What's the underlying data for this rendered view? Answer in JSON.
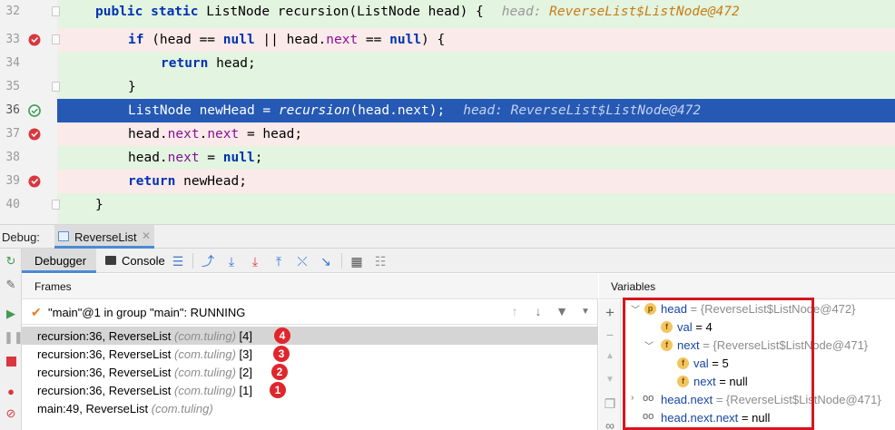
{
  "editor": {
    "lines": [
      {
        "num": "32",
        "bg": "green",
        "breakpoint": false
      },
      {
        "num": "33",
        "bg": "red",
        "breakpoint": true
      },
      {
        "num": "34",
        "bg": "green",
        "breakpoint": false
      },
      {
        "num": "35",
        "bg": "green",
        "breakpoint": false
      },
      {
        "num": "36",
        "bg": "selected",
        "breakpoint": "current"
      },
      {
        "num": "37",
        "bg": "red",
        "breakpoint": true
      },
      {
        "num": "38",
        "bg": "green",
        "breakpoint": false
      },
      {
        "num": "39",
        "bg": "red",
        "breakpoint": true
      },
      {
        "num": "40",
        "bg": "green",
        "breakpoint": false
      }
    ],
    "code": {
      "l32_kw": "public static",
      "l32_rest": " ListNode recursion(ListNode head) {",
      "l32_hint_label": "head: ",
      "l32_hint_value": "ReverseList$ListNode@472",
      "l33_kw1": "if",
      "l33_a": " (head == ",
      "l33_null1": "null",
      "l33_b": " || head.",
      "l33_next": "next",
      "l33_c": " == ",
      "l33_null2": "null",
      "l33_d": ") {",
      "l34_kw": "return",
      "l34_rest": " head;",
      "l35": "}",
      "l36_a": "ListNode newHead = ",
      "l36_call": "recursion",
      "l36_b": "(head.next);",
      "l36_hint": "head: ReverseList$ListNode@472",
      "l37_a": "head.",
      "l37_next1": "next",
      "l37_b": ".",
      "l37_next2": "next",
      "l37_c": " = head;",
      "l38_a": "head.",
      "l38_next": "next",
      "l38_b": " = ",
      "l38_null": "null",
      "l38_c": ";",
      "l39_kw": "return",
      "l39_rest": " newHead;",
      "l40": "}"
    }
  },
  "debug_bar": {
    "label": "Debug:",
    "run_tab": "ReverseList",
    "close_glyph": "✕"
  },
  "toolbar": {
    "tab_debugger": "Debugger",
    "tab_console": "Console"
  },
  "frames": {
    "header": "Frames",
    "thread": "\"main\"@1 in group \"main\": RUNNING",
    "items": [
      {
        "method": "recursion:36, ReverseList ",
        "pkg": "(com.tuling)",
        "depth": " [4]",
        "badge": "4",
        "selected": true
      },
      {
        "method": "recursion:36, ReverseList ",
        "pkg": "(com.tuling)",
        "depth": " [3]",
        "badge": "3",
        "selected": false
      },
      {
        "method": "recursion:36, ReverseList ",
        "pkg": "(com.tuling)",
        "depth": " [2]",
        "badge": "2",
        "selected": false
      },
      {
        "method": "recursion:36, ReverseList ",
        "pkg": "(com.tuling)",
        "depth": " [1]",
        "badge": "1",
        "selected": false
      },
      {
        "method": "main:49, ReverseList ",
        "pkg": "(com.tuling)",
        "depth": "",
        "badge": "",
        "selected": false
      }
    ]
  },
  "variables": {
    "header": "Variables",
    "head_name": "head",
    "head_value": " = {ReverseList$ListNode@472}",
    "val_name": "val",
    "val_value": " = 4",
    "next_name": "next",
    "next_value": " = {ReverseList$ListNode@471}",
    "next_val_name": "val",
    "next_val_value": " = 5",
    "next_next_name": "next",
    "next_next_value": " = null",
    "watch1_name": "head.next",
    "watch1_value": " = {ReverseList$ListNode@471}",
    "watch2_name": "head.next.next",
    "watch2_value": " = null",
    "icon_param": "p",
    "icon_field": "f"
  },
  "colors": {
    "keyword": "#0033b3",
    "field": "#871094",
    "selection": "#2559b4",
    "badge": "#e0262d",
    "highlight_box": "#d6161d"
  }
}
